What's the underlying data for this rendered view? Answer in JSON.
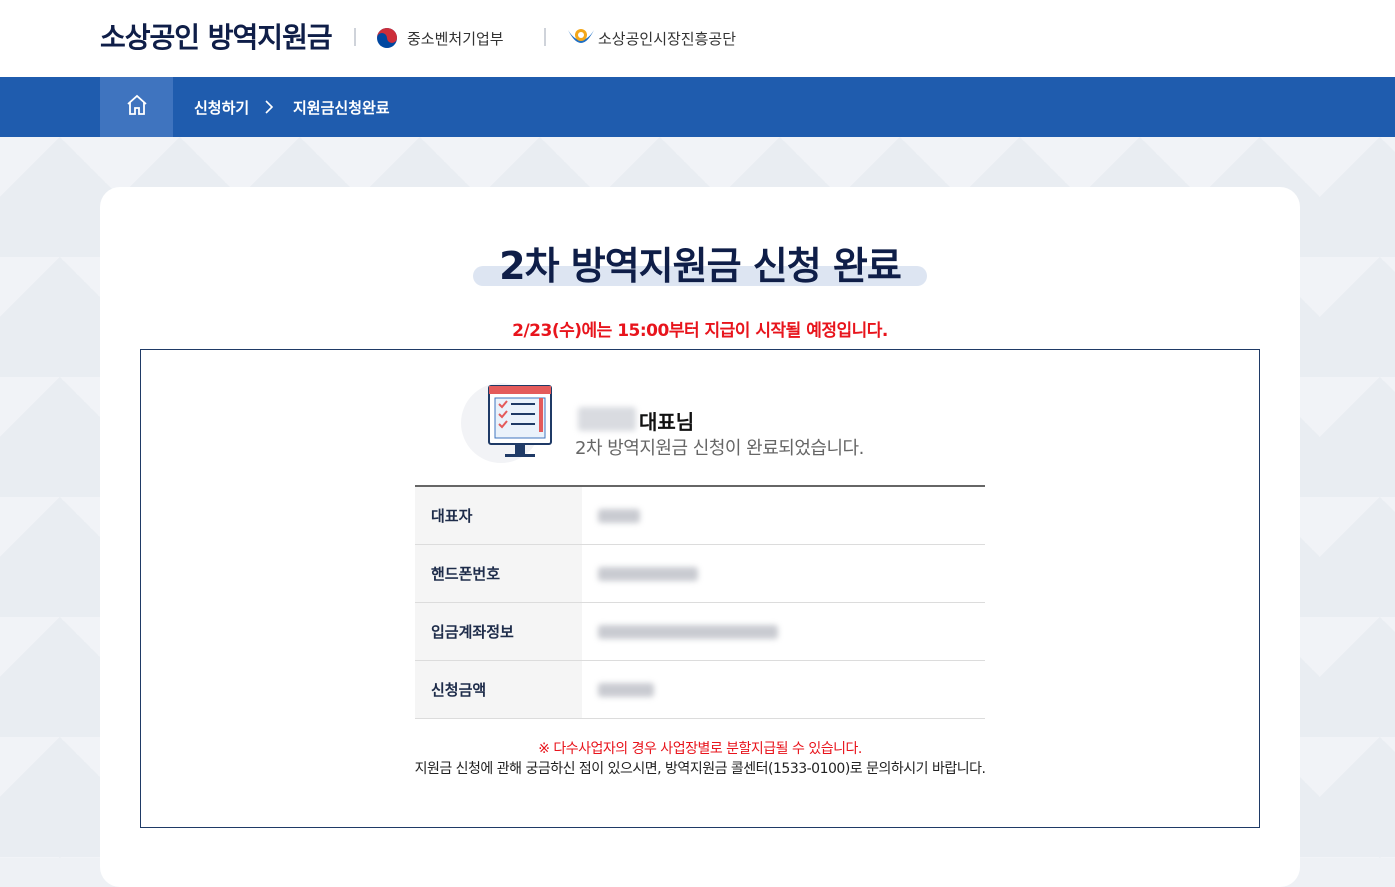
{
  "header": {
    "site_title": "소상공인 방역지원금",
    "partners": [
      {
        "name": "중소벤처기업부",
        "icon": "taegeuk-icon"
      },
      {
        "name": "소상공인시장진흥공단",
        "icon": "semas-logo-icon"
      }
    ]
  },
  "nav": {
    "home_icon": "home-icon",
    "breadcrumb": [
      "신청하기",
      "지원금신청완료"
    ],
    "separator": ">"
  },
  "main": {
    "title": "2차 방역지원금 신청 완료",
    "payment_notice": "2/23(수)에는 15:00부터 지급이 시작될 예정입니다.",
    "greeting": {
      "name_suffix": "대표님",
      "message": "2차 방역지원금 신청이 완료되었습니다."
    },
    "info_rows": [
      {
        "label": "대표자"
      },
      {
        "label": "핸드폰번호"
      },
      {
        "label": "입금계좌정보"
      },
      {
        "label": "신청금액"
      }
    ],
    "footer_notice": "※ 다수사업자의 경우 사업장별로 분할지급될 수 있습니다.",
    "footer_contact": "지원금 신청에 관해 궁금하신 점이 있으시면, 방역지원금 콜센터(1533-0100)로 문의하시기 바랍니다."
  },
  "colors": {
    "navy": "#0f1e48",
    "nav_blue": "#1f5cae",
    "home_blue": "#3f74bf",
    "alert_red": "#e8141c"
  }
}
